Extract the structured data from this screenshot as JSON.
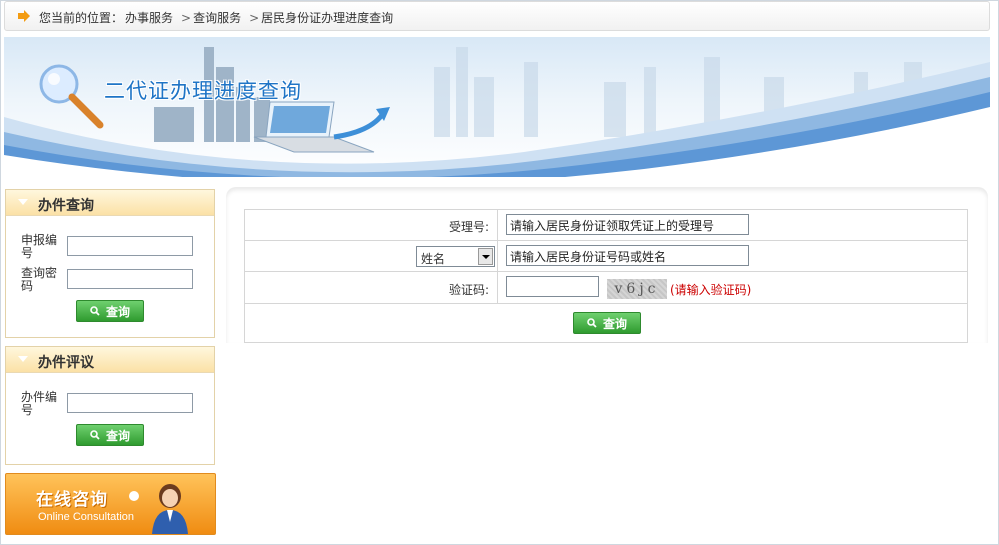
{
  "breadcrumb": {
    "prefix": "您当前的位置：",
    "items": [
      "办事服务",
      "查询服务",
      "居民身份证办理进度查询"
    ],
    "separator": ">"
  },
  "banner": {
    "title": "二代证办理进度查询"
  },
  "query_panel": {
    "title": "办件查询",
    "field1_label": "申报编号",
    "field2_label": "查询密码",
    "button": "查询"
  },
  "review_panel": {
    "title": "办件评议",
    "field_label": "办件编号",
    "button": "查询"
  },
  "consult": {
    "title": "在线咨询",
    "subtitle": "Online Consultation"
  },
  "form": {
    "receipt_label": "受理号:",
    "receipt_value": "请输入居民身份证领取凭证上的受理号",
    "select_value": "姓名",
    "idname_value": "请输入居民身份证号码或姓名",
    "captcha_label": "验证码:",
    "captcha_text": "v6jc",
    "captcha_hint": "(请输入验证码)",
    "button": "查询"
  },
  "colors": {
    "accent_green": "#2f9b2f",
    "banner_blue": "#1e74c6",
    "orange": "#f08c12"
  }
}
